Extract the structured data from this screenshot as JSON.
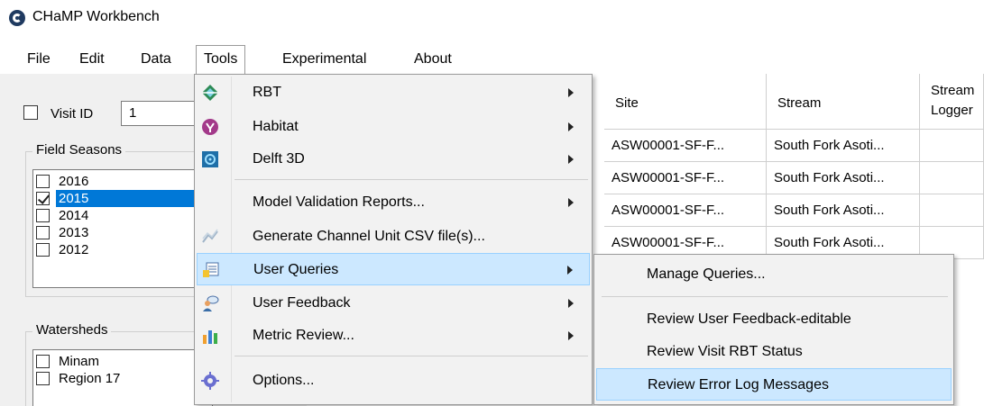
{
  "window": {
    "title": "CHaMP Workbench"
  },
  "menubar": {
    "items": [
      "File",
      "Edit",
      "Data",
      "Tools",
      "Experimental",
      "About"
    ],
    "active": "Tools"
  },
  "filters": {
    "visit_id_label": "Visit ID",
    "visit_id_value": "1",
    "field_seasons_title": "Field Seasons",
    "field_seasons": [
      {
        "label": "2016",
        "checked": false,
        "selected": false
      },
      {
        "label": "2015",
        "checked": true,
        "selected": true
      },
      {
        "label": "2014",
        "checked": false,
        "selected": false
      },
      {
        "label": "2013",
        "checked": false,
        "selected": false
      },
      {
        "label": "2012",
        "checked": false,
        "selected": false
      }
    ],
    "watersheds_title": "Watersheds",
    "watersheds": [
      {
        "label": "Minam",
        "checked": false
      },
      {
        "label": "Region 17",
        "checked": false
      }
    ]
  },
  "grid": {
    "columns": [
      "Site",
      "Stream",
      "Stream",
      "Logger"
    ],
    "rows": [
      {
        "site": "ASW00001-SF-F...",
        "stream": "South Fork Asoti..."
      },
      {
        "site": "ASW00001-SF-F...",
        "stream": "South Fork Asoti..."
      },
      {
        "site": "ASW00001-SF-F...",
        "stream": "South Fork Asoti..."
      },
      {
        "site": "ASW00001-SF-F...",
        "stream": "South Fork Asoti..."
      }
    ]
  },
  "tools_menu": {
    "items": [
      {
        "label": "RBT",
        "icon": "rbt-icon",
        "submenu": true
      },
      {
        "label": "Habitat",
        "icon": "habitat-icon",
        "submenu": true
      },
      {
        "label": "Delft 3D",
        "icon": "delft-icon",
        "submenu": true
      },
      {
        "label": "Model Validation Reports...",
        "icon": "",
        "submenu": true
      },
      {
        "label": "Generate Channel Unit CSV file(s)...",
        "icon": "channel-unit-icon",
        "submenu": false
      },
      {
        "label": "User Queries",
        "icon": "user-queries-icon",
        "submenu": true,
        "highlighted": true
      },
      {
        "label": "User Feedback",
        "icon": "user-feedback-icon",
        "submenu": true
      },
      {
        "label": "Metric Review...",
        "icon": "metric-review-icon",
        "submenu": true
      },
      {
        "label": "Options...",
        "icon": "gear-icon",
        "submenu": false
      }
    ]
  },
  "user_queries_submenu": {
    "items": [
      {
        "label": "Manage Queries..."
      },
      {
        "label": "Review User Feedback-editable"
      },
      {
        "label": "Review Visit RBT Status"
      },
      {
        "label": "Review Error Log Messages",
        "highlighted": true
      }
    ]
  },
  "colors": {
    "selection": "#0078d7",
    "menu_highlight": "#cce8ff",
    "menu_highlight_border": "#99d1ff",
    "app_icon": "#1f3a60"
  }
}
